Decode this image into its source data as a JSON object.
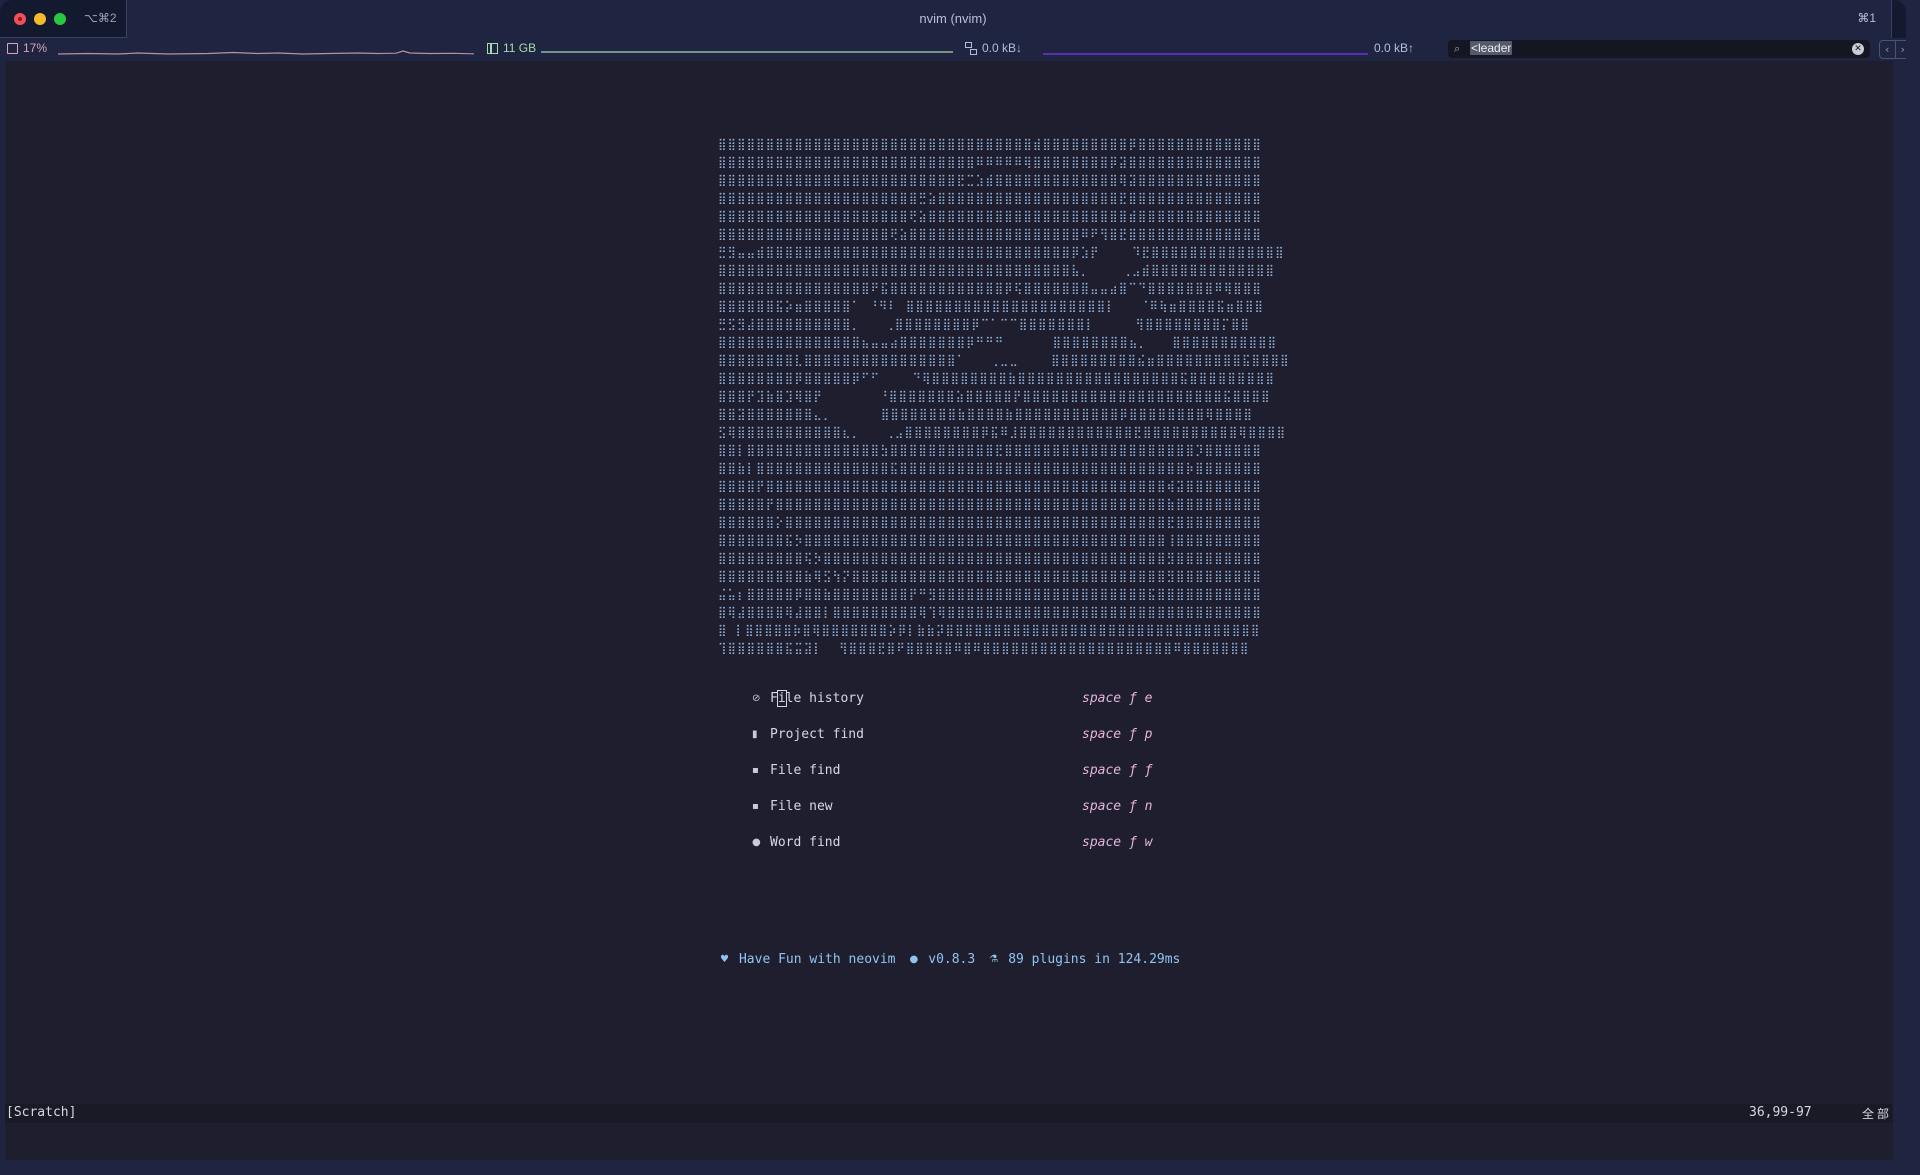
{
  "window": {
    "tab_shortcut": "⌥⌘2",
    "title": "nvim (nvim)",
    "window_shortcut": "⌘1"
  },
  "statusbar": {
    "cpu_icon": "cpu-chip-icon",
    "cpu_value": "17%",
    "memory_icon": "memory-icon",
    "memory_value": "11 GB",
    "network_icon": "network-icon",
    "net_down": "0.0 kB↓",
    "net_up": "0.0 kB↑",
    "colors": {
      "cpu": "#d6a6b8",
      "memory": "#a8d8b0",
      "network": "#5a2fb0"
    }
  },
  "search": {
    "icon": "search-icon",
    "value": "<leader",
    "clear_icon": "clear-icon",
    "prev_icon": "chevron-left-icon",
    "next_icon": "chevron-right-icon",
    "prev_glyph": "‹",
    "next_glyph": "›"
  },
  "dashboard": {
    "art": [
      "⣿⣿⣿⣿⣿⣿⣿⣿⣿⣿⣿⣿⣿⣿⣿⣿⣿⣿⣿⣿⣿⣿⣿⣿⣿⣿⣿⣿⣿⣿⣿⣿⣿⣾⣿⣿⣿⣿⣿⣿⣿⣿⣿⡿⣿⣿⣿⣿⣿⣿⣿⣿⣿⣿⣿⣿⣿",
      "⣿⣿⣿⣿⣿⣿⣿⣿⣿⣿⣿⣿⣿⣿⣿⣿⣿⣿⣿⣿⣿⣿⣿⣿⣿⣿⣿⠿⠿⠿⠿⠿⢿⣿⣿⣿⣿⣿⣿⣿⣿⡿⣽⣿⣿⣿⣿⣿⣿⣿⣿⣿⣿⣿⣿⣿⣿",
      "⣿⣿⣿⣿⣿⣿⣿⣿⣿⣿⣿⣿⣿⣿⣿⣿⣿⣿⣿⣿⣿⣿⣿⣿⣿⣟⣉⣱⣾⣿⣿⣿⣿⣿⣿⣿⣿⣿⣿⣿⣿⣿⢿⣽⣿⣿⣿⣿⣿⣿⣿⣿⣿⣿⣿⣿⣿",
      "⣿⣿⣿⣿⣿⣿⣿⣿⣿⣿⣿⣿⣿⣿⣿⣿⣿⣿⣿⣿⣿⣛⣵⣿⣿⣿⣿⣿⣿⣿⣿⣿⣿⣿⣿⣿⣿⣿⣿⣿⣿⣿⣟⣿⣿⣿⣿⣿⣿⣿⣿⣿⣿⣿⣿⣿⣿",
      "⣿⣿⣿⣿⣿⣿⣿⣿⣿⣿⣿⣿⣿⣿⣿⣿⣿⣿⣿⣿⢟⣵⣿⣿⣿⣿⣿⣿⣿⣿⣿⣿⣿⣿⣿⣿⣿⣿⣿⣿⣿⣿⣿⣾⣿⣿⣿⣿⣿⣿⣿⣿⣿⣿⣿⣿⣿",
      "⣿⣿⣿⣿⣿⣿⣿⣿⣿⣿⣿⣿⣿⣿⣿⣿⣿⣿⢟⣵⣿⣿⣿⣿⣿⣿⣿⣿⣿⣿⣿⣿⣿⣿⣿⣿⣿⣿⠿⠟⢻⣿⣟⣿⣿⣿⣿⣿⣿⣿⣿⣿⣿⣿⣿⣿⣿",
      "⣛⣻⣤⣤⣾⣿⣿⣿⣿⣿⣿⣿⣿⣿⣿⣿⣿⣿⣿⣿⣿⣿⣿⣿⣿⣿⣿⣿⣿⣿⣿⣿⣿⣿⣿⣿⣿⡿⣱⡟    ⠹⣟⣿⣿⣿⣿⣿⣿⣿⣿⣿⣿⣿⣿⣿⣿",
      "⣿⣿⣿⣿⣿⣿⣿⣿⣿⣿⣿⣿⣿⣿⣿⣿⣿⣿⣿⣿⣿⣿⣿⣿⣿⣿⣿⣿⣿⣿⣿⣿⣿⣿⣿⣿⣿⣧⡀    ⢀⣠⣾⣿⣿⣿⣿⣿⣿⣿⣿⣿⣿⣿⣿⣿",
      "⣿⣿⣿⣿⣿⣿⣿⣿⣿⣿⣿⣿⣿⣿⣿⣿⠟⣯⣿⣿⣿⣿⣿⣿⣿⣿⣿⣿⣿⣿⡿⢯⣿⣿⣿⣿⣿⣿⣿⣤⣤⣴⣿⠉⠙⣿⣿⣿⣿⣿⣿⣿⠿⢿⣿⣿⣿",
      "⣿⣿⣿⣿⣿⣿⣯⡵⣶⣿⣿⣿⣿⣿⠁ ⠘⠻⠇ ⣿⣿⣿⣿⣿⣿⣿⣿⣿⣿⣿⣿⣿⣿⣿⣿⣿⣿⣿⣿⣿⡇   ⠈⠿⢷⣶⣿⣿⣿⣿⣯⣶⣿⣿⣿",
      "⣛⣫⣻⣼⣿⣿⣿⣿⣿⣿⣿⣿⣿⣿⡀   ⢀⣿⣿⣿⣿⣿⣿⣿⣿⡿⠉⠁⠉⠉⣿⣿⣿⣿⣿⣿⣿⡇     ⢻⣿⣿⣿⣿⣿⣿⣿⣿⡍⣿⣿",
      "⣿⣿⣿⣿⣿⣿⣿⣿⣿⣿⣿⣿⣿⣿⣿⣦⣤⣤⣴⣿⣿⣿⣿⣿⣿⣿⡿⠛⠛⠛      ⣿⣿⣿⣿⣿⣿⣿⣿⣦⡀   ⣿⣿⣿⣿⣿⣿⣿⣿⣿⣿⣿",
      "⣿⣿⣿⣿⣿⣿⣿⣿⣇⣿⣿⣿⣿⣿⣿⣿⣿⣿⣿⣿⣿⣿⣿⣿⣿⠁   ⢀⣀⣀    ⣿⣿⣿⣿⣿⣿⣿⣿⣿⣮⣶⣿⣿⣿⣿⣿⣿⣿⣿⣿⣯⣿⣿⣿⣿",
      "⣿⣿⣿⣿⣿⣿⣿⣿⡿⣿⣿⣿⣿⣿⡿⠋⠋    ⠙⢿⣿⣿⣿⣿⣿⣿⣿⣿⣷⣿⣿⣿⣿⣿⣿⣿⣿⣿⣿⣿⣿⣿⣿⣿⣿⣿⣯⣿⣿⣿⣿⣿⣿⣿⣿⣿",
      "⣿⣿⣿⡟⣹⣷⣿⣹⢿⣿⡟       ⠘⣿⣿⣿⣿⣿⣿⣿⣵⣿⣿⣿⣿⣿⡟⣿⣿⣿⣿⣿⣿⣿⣿⣿⣿⣿⣿⣿⣿⣿⣿⣿⣿⣿⣿⣿⣯⣿⣿⣿⣿",
      "⣿⣿⣽⣿⣿⣿⣿⣿⣿⣿⣄⡀      ⣿⣿⣿⣿⣿⣿⣿⣿⣷⣿⣿⣿⣿⣷⣿⣿⣿⣿⣿⣿⣿⣿⣿⣿⣿⡿⣿⣿⣿⣿⣿⣿⣿⣿⢿⣿⣿⣿⣿",
      "⣫⢿⣿⣿⣿⣿⣿⣿⣿⣿⣿⣿⣿⣆⡀   ⢀⣠⣿⣿⣿⣿⣿⣿⣿⣿⡿⣯⠿⣸⣿⣿⣿⣿⣿⣿⣿⣿⣿⣿⣿⣿⣟⣿⣿⣿⣿⣿⣿⣿⣿⣿⣿⢿⣿⣿⣿⣿",
      "⣿⣿⡇⣿⣿⣿⣿⣿⣿⣿⣿⣿⣿⣿⣿⣿⣿⣳⣿⣿⣿⣿⣿⣿⣿⣿⣿⣿⣿⣟⣿⣿⣿⣿⣿⣿⣿⣿⣿⣿⣿⣿⣿⣿⣿⣿⣿⣿⣿⣿⡹⣿⣿⣿⣿⣿⣿",
      "⣿⣿⣷⡇⣿⣿⣿⣿⣿⣿⣿⣿⣿⣿⣿⣿⣿⣿⣯⣿⣿⣿⣿⣿⣿⣿⣿⣿⣿⣿⣿⣿⣿⣿⣿⣿⣿⣿⣿⣿⣿⣿⣿⣿⣿⣿⣿⣿⣿⡷⣿⣿⣿⣿⣿⣿⣿",
      "⣿⣿⣿⣿⡟⣿⣿⣿⣿⣿⣿⣿⣿⣿⣿⣿⣿⣿⣿⣿⣿⣿⣿⣿⣿⣿⣿⣿⣿⣿⣿⣿⣿⣿⣿⣿⣿⣿⣿⣿⣿⣿⣿⣿⣿⣿⣿⢾⣽⣿⣿⣿⣿⣿⣿⣿⣿",
      "⣿⣿⣿⣿⣿⡟⣿⣿⣿⣿⣿⣿⣿⣿⣿⣿⣿⣿⣿⣿⣿⣿⣿⣿⣿⣿⣿⣿⣿⣿⣿⣿⣿⣿⣿⣿⣿⣿⣿⣿⣿⣿⣿⣿⣿⣿⣿⣷⣿⣿⣿⣿⣿⣿⣿⣿⣿",
      "⣿⣿⣿⣿⣿⣿⡕⣿⣿⣿⣿⣿⣿⣿⣿⣿⣿⣿⣿⣿⣿⣿⣿⣿⣿⣿⣿⣿⣿⣿⣿⣿⣿⣿⣿⣿⣿⣿⣿⣿⣿⣿⣿⣿⣿⣿⣿⣟⣿⣿⣿⣿⣿⣿⣿⣿⣿",
      "⣿⣿⣿⣿⣿⣿⣿⣯⡳⣿⣿⣿⣿⣿⣿⣿⣿⣿⣿⣿⣿⣿⣿⣿⣿⣿⣿⣿⣿⣿⣿⣿⣿⣿⣿⣿⣿⣿⣿⣿⣿⣿⣿⣿⣿⣿⣿⢸⣿⣿⣿⣿⣿⣿⣿⣿⣿",
      "⣿⣿⣿⣿⣿⣿⣿⣿⣿⢯⡳⣿⣿⣿⣿⣿⣿⣿⣿⣿⣿⣿⣿⣿⣿⣿⣿⣿⣿⣿⣿⣿⣿⣿⣿⣿⣿⣿⣿⣿⣿⣿⣿⣿⣿⣿⣿⣻⣿⣿⣿⣿⣿⣿⣿⣿⣿",
      "⣿⣿⣿⣿⣿⣿⣿⣿⣿⣷⢿⣫⢳⡝⣿⣿⣿⣿⣿⣿⣿⣿⣿⣿⣿⣿⣿⣿⣿⣿⣿⣿⣿⣿⣿⣿⣿⣿⣿⣿⣿⣿⣿⣿⣿⣿⣿⣻⣿⣿⣿⣿⣿⣿⣿⣿⣿",
      "⣬⣥⡆⣿⣿⣿⣿⣿⡿⣿⣿⣷⣿⣿⣿⣿⣿⣿⣿⣿⡟⠛⣻⣿⣿⣿⣿⣿⣿⣿⣿⣿⣿⣿⣿⣿⣿⣿⣿⣿⣿⣿⣿⣿⣿⣯⣿⣿⣿⣿⣿⣿⣿⣿⣿⣿⣿",
      "⣿⢿⣼⣿⣿⣿⣿⢿⣼⣿⣿⡇⣿⣿⣿⣿⣿⣿⣿⣿⣿⢿⢹⢿⣿⣿⣿⣿⣿⣿⣿⣿⣿⣿⣿⣿⣿⣿⣿⣿⣿⣿⣿⣿⣿⣿⣿⣿⣿⣿⣿⣿⣿⣿⣿⣿⣿",
      "⣿ ⡇⣿⣿⣿⣿⣿⡷⣿⢿⣿⣿⣿⣿⣿⣿⣿⡵⡿⡇⣷⣷⡽⣿⣿⣿⣿⣿⣿⣿⣿⣿⣿⣿⣿⣿⣿⣿⣿⣿⣿⣿⣿⣿⣿⣿⣿⣿⣿⣿⣿⣿⣿⣿⣿⣿",
      "⢹⣿⣿⣿⣿⣿⣿⣯⣭⣽⡇  ⢻⣿⣿⣿⣟⣿⠟⣿⣿⣿⣿⣿⠿⣿⠿⣿⣿⣿⣿⣿⣿⣿⣿⣿⣿⣿⣿⣿⣿⣿⣿⣿⣿⣿⣿⠿⣿⣿⣿⣿⣿⣿⣿"
    ],
    "menu": [
      {
        "icon": "history-icon",
        "glyph": "⊘",
        "label": "File history",
        "keys": "space ƒ e"
      },
      {
        "icon": "bookmark-icon",
        "glyph": "▮",
        "label": "Project find",
        "keys": "space ƒ p"
      },
      {
        "icon": "file-search-icon",
        "glyph": "▪",
        "label": "File find",
        "keys": "space ƒ ƒ"
      },
      {
        "icon": "file-new-icon",
        "glyph": "▪",
        "label": "File new",
        "keys": "space ƒ n"
      },
      {
        "icon": "word-find-icon",
        "glyph": "●",
        "label": "Word find",
        "keys": "space ƒ w"
      }
    ],
    "footer": {
      "heart_glyph": "♥",
      "message": "Have Fun with neovim",
      "version_glyph": "●",
      "version": "v0.8.3",
      "plugins_glyph": "⚗",
      "plugins": "89 plugins in 124.29ms"
    }
  },
  "statusline": {
    "buffer": "[Scratch]",
    "position": "36,99-97",
    "percent": "全部"
  }
}
